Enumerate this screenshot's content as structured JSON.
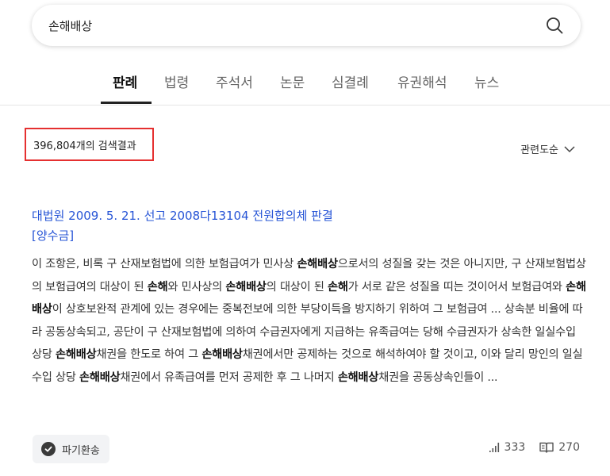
{
  "search": {
    "query": "손해배상"
  },
  "tabs": [
    {
      "label": "판례",
      "active": true
    },
    {
      "label": "법령"
    },
    {
      "label": "주석서"
    },
    {
      "label": "논문"
    },
    {
      "label": "심결례"
    },
    {
      "label": "유권해석"
    },
    {
      "label": "뉴스"
    }
  ],
  "results_count": "396,804개의 검색결과",
  "sort_label": "관련도순",
  "result": {
    "title_line1": "대법원 2009. 5. 21. 선고 2008다13104 전원합의체 판결",
    "title_line2": "[양수금]",
    "segments": [
      {
        "t": "이 조항은, 비록 구 산재보험법에 의한 보험급여가 민사상 "
      },
      {
        "t": "손해배상",
        "b": true
      },
      {
        "t": "으로서의 성질을 갖는 것은 아니지만, 구 산재보험법상의 보험급여의 대상이 된 "
      },
      {
        "t": "손해",
        "b": true
      },
      {
        "t": "와 민사상의 "
      },
      {
        "t": "손해배상",
        "b": true
      },
      {
        "t": "의 대상이 된 "
      },
      {
        "t": "손해",
        "b": true
      },
      {
        "t": "가 서로 같은 성질을 띠는 것이어서 보험급여와 "
      },
      {
        "t": "손해배상",
        "b": true
      },
      {
        "t": "이 상호보완적 관계에 있는 경우에는 중복전보에 의한 부당이득을 방지하기 위하여 그 보험급여 ... 상속분 비율에 따라 공동상속되고, 공단이 구 산재보험법에 의하여 수급권자에게 지급하는 유족급여는 당해 수급권자가 상속한 일실수입 상당 "
      },
      {
        "t": "손해배상",
        "b": true
      },
      {
        "t": "채권을 한도로 하여 그 "
      },
      {
        "t": "손해배상",
        "b": true
      },
      {
        "t": "채권에서만 공제하는 것으로 해석하여야 할 것이고, 이와 달리 망인의 일실수입 상당 "
      },
      {
        "t": "손해배상",
        "b": true
      },
      {
        "t": "채권에서 유족급여를 먼저 공제한 후 그 나머지 "
      },
      {
        "t": "손해배상",
        "b": true
      },
      {
        "t": "채권을 공동상속인들이 ..."
      }
    ],
    "badge_label": "파기환송",
    "views": "333",
    "cites": "270"
  }
}
